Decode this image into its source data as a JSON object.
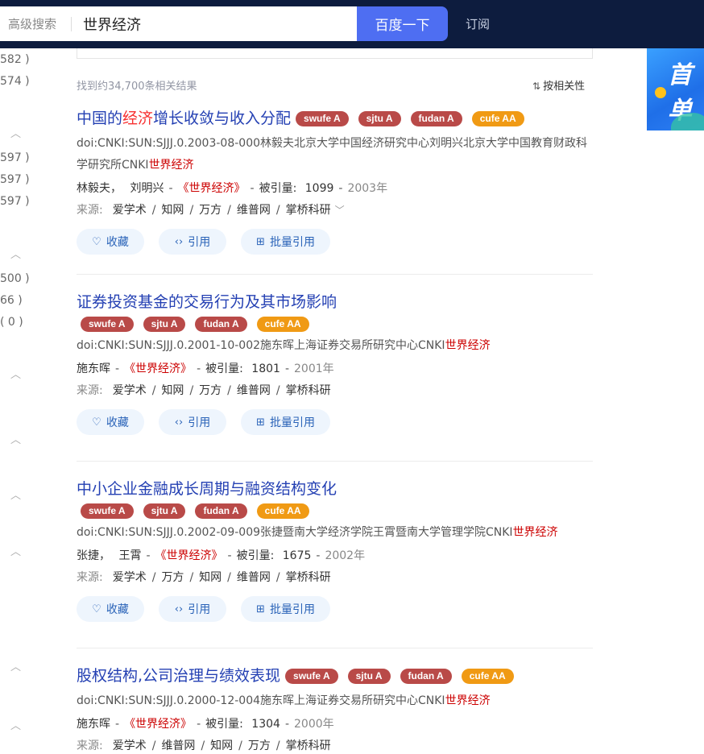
{
  "header": {
    "advanced_search": "高级搜索",
    "query": "世界经济",
    "search_button": "百度一下",
    "subscribe": "订阅"
  },
  "left_col": {
    "counts": [
      "582 )",
      "574 )",
      "597 )",
      "597 )",
      "597 )",
      "500 )",
      "66 )",
      "( 0 )"
    ]
  },
  "ad": {
    "text": "首单"
  },
  "results_summary": "找到约34,700条相关结果",
  "sort_label": "按相关性",
  "actions": {
    "favorite": "收藏",
    "cite": "引用",
    "batch_cite": "批量引用"
  },
  "source_label": "来源:",
  "cited_label": "被引量:",
  "tags": [
    {
      "label": "swufe A",
      "color": "#b94a48"
    },
    {
      "label": "sjtu A",
      "color": "#b94a48"
    },
    {
      "label": "fudan A",
      "color": "#b94a48"
    },
    {
      "label": "cufe AA",
      "color": "#f09a14"
    }
  ],
  "results": [
    {
      "title_pre": "中国的",
      "title_hl": "经济",
      "title_post": "增长收敛与收入分配",
      "doi": "doi:CNKI:SUN:SJJJ.0.2003-08-000林毅夫北京大学中国经济研究中心刘明兴北京大学中国教育财政科学研究所CNKI",
      "doi_hl": "世界经济",
      "authors": [
        "林毅夫",
        "刘明兴"
      ],
      "journal": "《世界经济》",
      "cited": "1099",
      "year": "2003年",
      "sources": [
        "爱学术",
        "知网",
        "万方",
        "维普网",
        "掌桥科研"
      ]
    },
    {
      "title_pre": "证券投资基金的交易行为及其市场影响",
      "title_hl": "",
      "title_post": "",
      "doi": "doi:CNKI:SUN:SJJJ.0.2001-10-002施东晖上海证券交易所研究中心CNKI",
      "doi_hl": "世界经济",
      "authors": [
        "施东晖"
      ],
      "journal": "《世界经济》",
      "cited": "1801",
      "year": "2001年",
      "sources": [
        "爱学术",
        "知网",
        "万方",
        "维普网",
        "掌桥科研"
      ]
    },
    {
      "title_pre": "中小企业金融成长周期与融资结构变化",
      "title_hl": "",
      "title_post": "",
      "doi": "doi:CNKI:SUN:SJJJ.0.2002-09-009张捷暨南大学经济学院王霄暨南大学管理学院CNKI",
      "doi_hl": "世界经济",
      "authors": [
        "张捷",
        "王霄"
      ],
      "journal": "《世界经济》",
      "cited": "1675",
      "year": "2002年",
      "sources": [
        "爱学术",
        "万方",
        "知网",
        "维普网",
        "掌桥科研"
      ]
    },
    {
      "title_pre": "股权结构,公司治理与绩效表现",
      "title_hl": "",
      "title_post": "",
      "doi": "doi:CNKI:SUN:SJJJ.0.2000-12-004施东晖上海证券交易所研究中心CNKI",
      "doi_hl": "世界经济",
      "authors": [
        "施东晖"
      ],
      "journal": "《世界经济》",
      "cited": "1304",
      "year": "2000年",
      "sources": [
        "爱学术",
        "维普网",
        "知网",
        "万方",
        "掌桥科研"
      ]
    }
  ]
}
